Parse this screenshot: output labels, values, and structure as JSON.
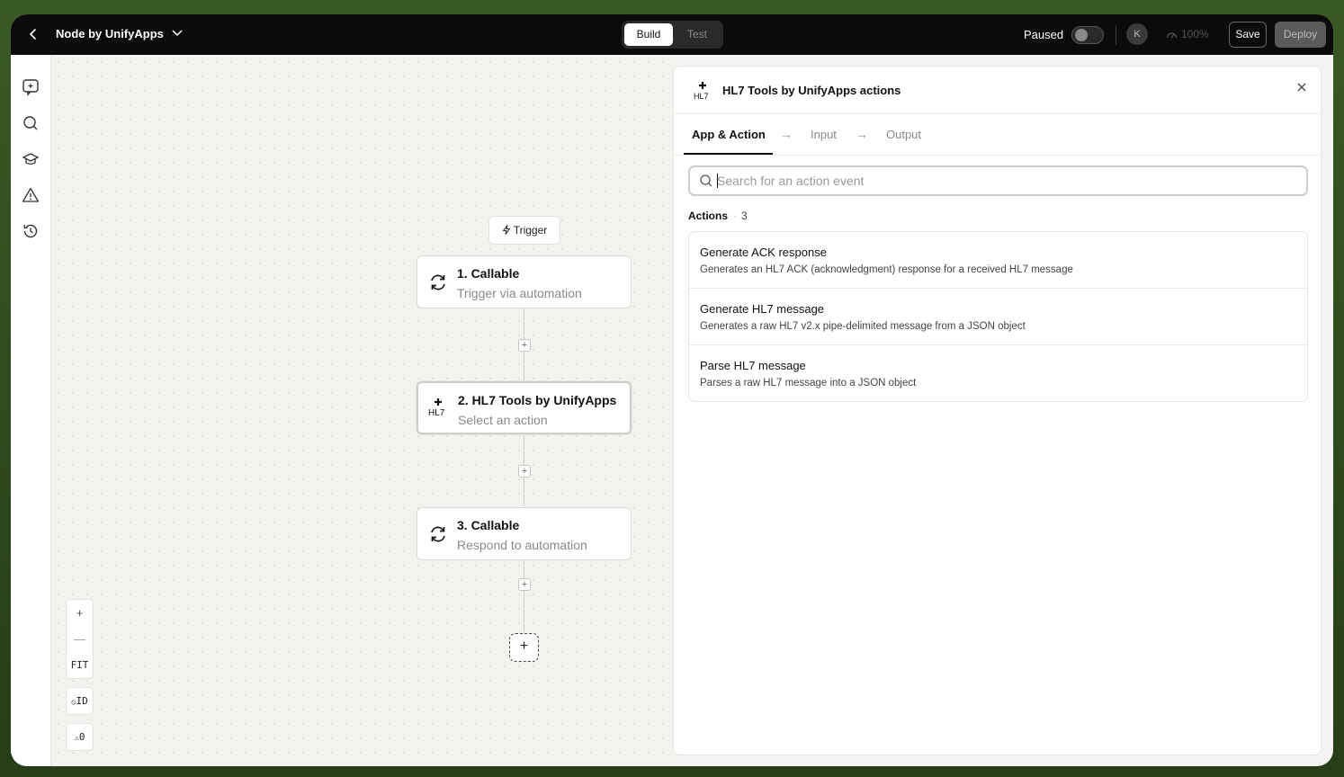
{
  "topbar": {
    "title": "Node by UnifyApps",
    "modes": [
      "Build",
      "Test"
    ],
    "active_mode": "Build",
    "paused_label": "Paused",
    "paused": true,
    "avatar_initial": "K",
    "zoom_level": "100%",
    "save_label": "Save",
    "deploy_label": "Deploy"
  },
  "sidebar": {
    "items": [
      {
        "icon": "ai-sparkle-icon"
      },
      {
        "icon": "search-icon"
      },
      {
        "icon": "learn-icon"
      },
      {
        "icon": "warning-icon"
      },
      {
        "icon": "history-icon"
      }
    ]
  },
  "canvas": {
    "trigger_label": "Trigger",
    "nodes": [
      {
        "title": "1. Callable",
        "subtitle": "Trigger via automation",
        "icon": "sync-icon"
      },
      {
        "title": "2. HL7 Tools by UnifyApps",
        "subtitle": "Select an action",
        "icon": "hl7-icon",
        "selected": true
      },
      {
        "title": "3. Callable",
        "subtitle": "Respond to automation",
        "icon": "sync-icon"
      }
    ],
    "controls": {
      "zoom_in": "+",
      "zoom_out": "—",
      "fit": "FIT",
      "id_toggle": "ID",
      "warnings": "0"
    }
  },
  "panel": {
    "title": "HL7 Tools by UnifyApps actions",
    "tabs": [
      "App & Action",
      "Input",
      "Output"
    ],
    "active_tab": "App & Action",
    "search": {
      "placeholder": "Search for an action event",
      "value": ""
    },
    "actions_label": "Actions",
    "actions_count": "3",
    "actions": [
      {
        "title": "Generate ACK response",
        "description": "Generates an HL7 ACK (acknowledgment) response for a received HL7 message"
      },
      {
        "title": "Generate HL7 message",
        "description": "Generates a raw HL7 v2.x pipe-delimited message from a JSON object"
      },
      {
        "title": "Parse HL7 message",
        "description": "Parses a raw HL7 message into a JSON object"
      }
    ]
  }
}
